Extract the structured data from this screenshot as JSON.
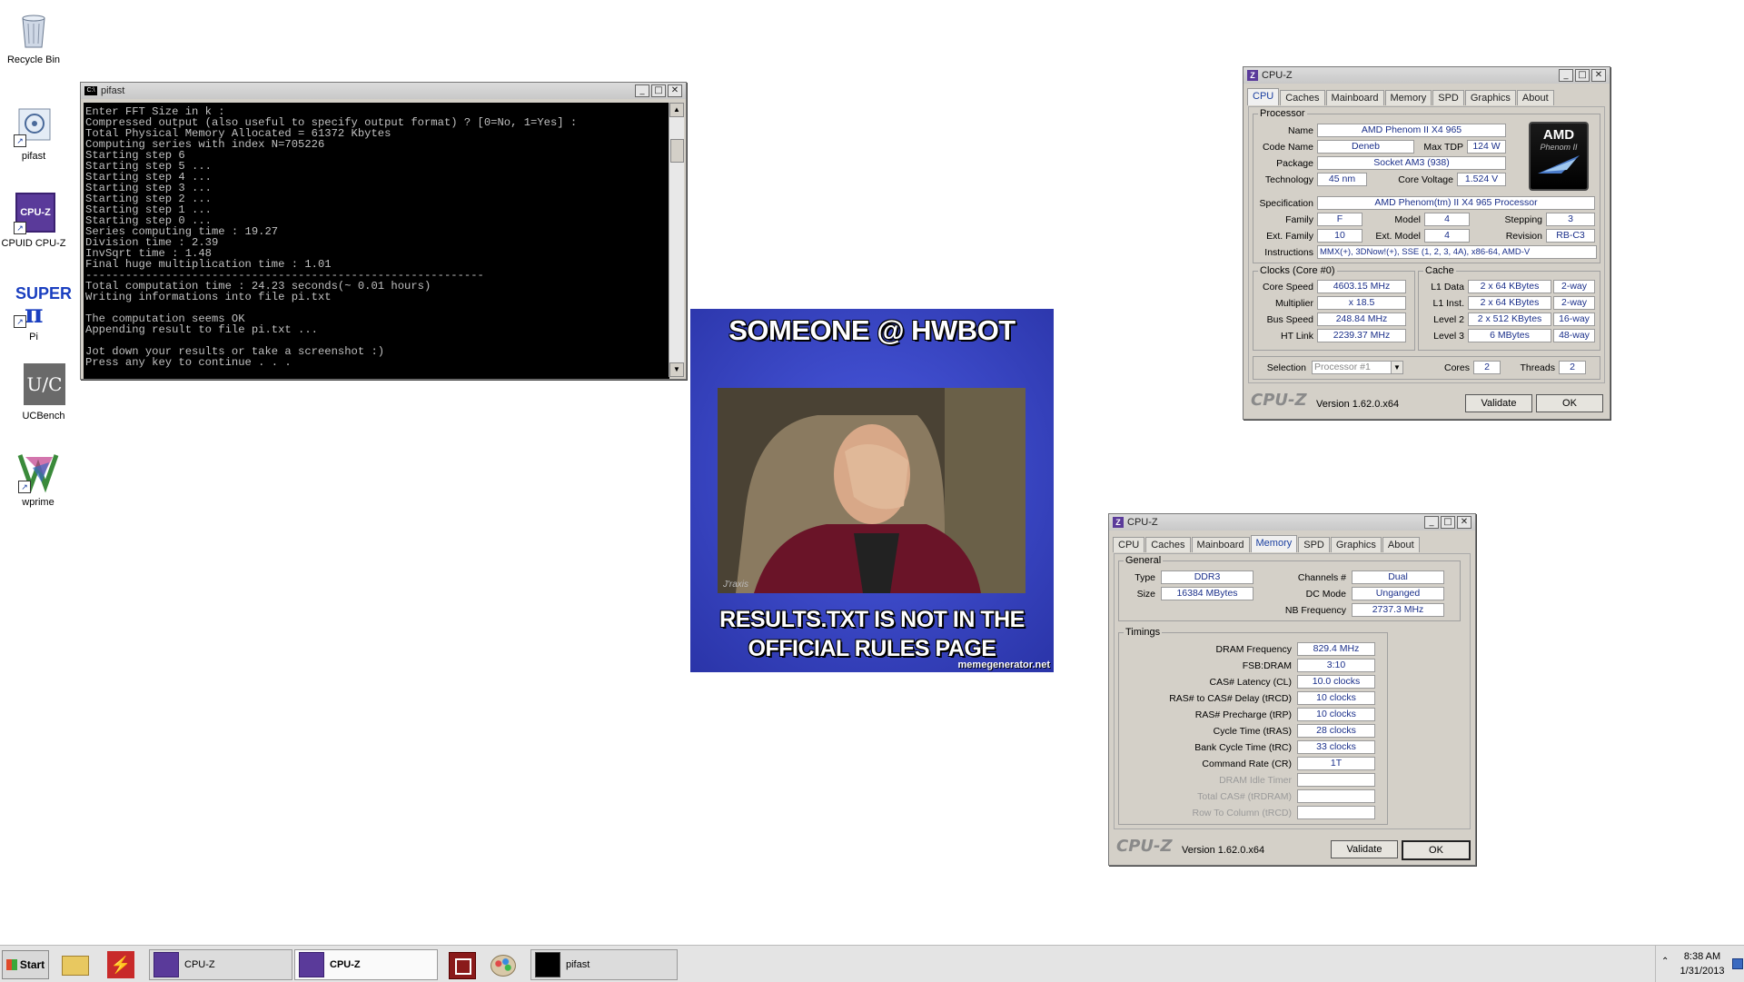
{
  "desktop": {
    "icons": [
      {
        "label": "Recycle Bin"
      },
      {
        "label": "pifast"
      },
      {
        "label": "CPUID CPU-Z"
      },
      {
        "label": "Pi"
      },
      {
        "label": "UCBench"
      },
      {
        "label": "wprime"
      }
    ],
    "superpi_text": {
      "top": "SUPER",
      "bottom": "Pi"
    },
    "cpuz_icon_text": "CPU-Z",
    "ucbench_text": "U/C"
  },
  "pifast": {
    "title": "pifast",
    "icon_text": "C:\\",
    "lines": [
      "Enter FFT Size in k :",
      "Compressed output (also useful to specify output format) ? [0=No, 1=Yes] :",
      "Total Physical Memory Allocated = 61372 Kbytes",
      "Computing series with index N=705226",
      "Starting step 6",
      "Starting step 5 ...",
      "Starting step 4 ...",
      "Starting step 3 ...",
      "Starting step 2 ...",
      "Starting step 1 ...",
      "Starting step 0 ...",
      "Series computing time : 19.27",
      "Division time : 2.39",
      "InvSqrt time : 1.48",
      "Final huge multiplication time : 1.01",
      "------------------------------------------------------------",
      "Total computation time : 24.23 seconds(~ 0.01 hours)",
      "Writing informations into file pi.txt",
      "",
      "The computation seems OK",
      "Appending result to file pi.txt ...",
      "",
      "Jot down your results or take a screenshot :)",
      "Press any key to continue . . ."
    ]
  },
  "meme": {
    "top_text": "SOMEONE @ HWBOT",
    "bottom_text": "RESULTS.TXT IS NOT IN THE OFFICIAL RULES PAGE",
    "watermark": "memegenerator.net",
    "signature": "J'raxis"
  },
  "cpuz1": {
    "title": "CPU-Z",
    "tabs": [
      "CPU",
      "Caches",
      "Mainboard",
      "Memory",
      "SPD",
      "Graphics",
      "About"
    ],
    "active_tab": "CPU",
    "processor_group": "Processor",
    "labels": {
      "name": "Name",
      "codename": "Code Name",
      "maxtdp": "Max TDP",
      "package": "Package",
      "technology": "Technology",
      "corevoltage": "Core Voltage",
      "specification": "Specification",
      "family": "Family",
      "model": "Model",
      "stepping": "Stepping",
      "extfamily": "Ext. Family",
      "extmodel": "Ext. Model",
      "revision": "Revision",
      "instructions": "Instructions"
    },
    "values": {
      "name": "AMD Phenom II X4 965",
      "codename": "Deneb",
      "maxtdp": "124 W",
      "package": "Socket AM3 (938)",
      "technology": "45 nm",
      "corevoltage": "1.524 V",
      "specification": "AMD Phenom(tm) II X4 965 Processor",
      "family": "F",
      "model": "4",
      "stepping": "3",
      "extfamily": "10",
      "extmodel": "4",
      "revision": "RB-C3",
      "instructions": "MMX(+), 3DNow!(+), SSE (1, 2, 3, 4A), x86-64, AMD-V"
    },
    "logo": {
      "brand": "AMD",
      "line": "Phenom II"
    },
    "clocks_group": "Clocks (Core #0)",
    "clocks": [
      {
        "label": "Core Speed",
        "value": "4603.15 MHz"
      },
      {
        "label": "Multiplier",
        "value": "x 18.5"
      },
      {
        "label": "Bus Speed",
        "value": "248.84 MHz"
      },
      {
        "label": "HT Link",
        "value": "2239.37 MHz"
      }
    ],
    "cache_group": "Cache",
    "cache": [
      {
        "label": "L1 Data",
        "size": "2 x 64 KBytes",
        "way": "2-way"
      },
      {
        "label": "L1 Inst.",
        "size": "2 x 64 KBytes",
        "way": "2-way"
      },
      {
        "label": "Level 2",
        "size": "2 x 512 KBytes",
        "way": "16-way"
      },
      {
        "label": "Level 3",
        "size": "6 MBytes",
        "way": "48-way"
      }
    ],
    "selection_label": "Selection",
    "selection_value": "Processor #1",
    "cores_label": "Cores",
    "cores_value": "2",
    "threads_label": "Threads",
    "threads_value": "2",
    "brand": "CPU-Z",
    "version": "Version 1.62.0.x64",
    "validate": "Validate",
    "ok": "OK"
  },
  "cpuz2": {
    "title": "CPU-Z",
    "tabs": [
      "CPU",
      "Caches",
      "Mainboard",
      "Memory",
      "SPD",
      "Graphics",
      "About"
    ],
    "active_tab": "Memory",
    "general_group": "General",
    "general": {
      "type_label": "Type",
      "type": "DDR3",
      "size_label": "Size",
      "size": "16384 MBytes",
      "channels_label": "Channels #",
      "channels": "Dual",
      "dcmode_label": "DC Mode",
      "dcmode": "Unganged",
      "nbfreq_label": "NB Frequency",
      "nbfreq": "2737.3 MHz"
    },
    "timings_group": "Timings",
    "timings": [
      {
        "label": "DRAM Frequency",
        "value": "829.4 MHz"
      },
      {
        "label": "FSB:DRAM",
        "value": "3:10"
      },
      {
        "label": "CAS# Latency (CL)",
        "value": "10.0 clocks"
      },
      {
        "label": "RAS# to CAS# Delay (tRCD)",
        "value": "10 clocks"
      },
      {
        "label": "RAS# Precharge (tRP)",
        "value": "10 clocks"
      },
      {
        "label": "Cycle Time (tRAS)",
        "value": "28 clocks"
      },
      {
        "label": "Bank Cycle Time (tRC)",
        "value": "33 clocks"
      },
      {
        "label": "Command Rate (CR)",
        "value": "1T"
      },
      {
        "label": "DRAM Idle Timer",
        "value": ""
      },
      {
        "label": "Total CAS# (tRDRAM)",
        "value": ""
      },
      {
        "label": "Row To Column (tRCD)",
        "value": ""
      }
    ],
    "brand": "CPU-Z",
    "version": "Version 1.62.0.x64",
    "validate": "Validate",
    "ok": "OK"
  },
  "taskbar": {
    "start": "Start",
    "items": [
      {
        "label": "CPU-Z",
        "active": false
      },
      {
        "label": "CPU-Z",
        "active": true
      },
      {
        "label": "pifast",
        "active": false
      }
    ],
    "time": "8:38 AM",
    "date": "1/31/2013"
  }
}
